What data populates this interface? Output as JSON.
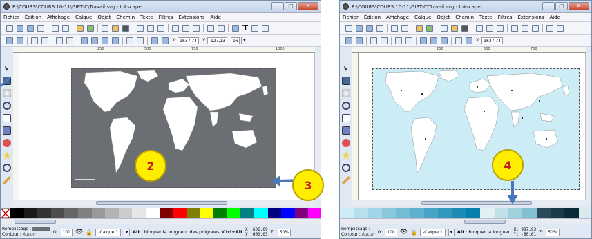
{
  "left_window": {
    "title": "E:\\COURS\\COURS 10-11\\GIPTIC\\Travail.svg - Inkscape",
    "menu": [
      "Fichier",
      "Édition",
      "Affichage",
      "Calque",
      "Objet",
      "Chemin",
      "Texte",
      "Filtres",
      "Extensions",
      "Aide"
    ],
    "x_value": "1637,74",
    "y_value": "-127,13",
    "unit": "px",
    "ruler_marks": [
      "250",
      "500",
      "750",
      "1000"
    ],
    "status": {
      "fill_label": "Remplissage :",
      "stroke_label": "Contour :",
      "stroke_value": "Aucun",
      "opacity_label": "O:",
      "opacity_value": "100",
      "layer": "-Calque 1",
      "message_bold": "Alt",
      "message": " : bloquer la longueur des poignées; ",
      "message_bold2": "Ctrl+Alt",
      "x_coord": "X:  606.09",
      "y_coord": "Y:  600.03",
      "zoom_label": "Z:",
      "zoom": "50%"
    },
    "map_color": "#6b6e72"
  },
  "right_window": {
    "title": "E:\\COURS\\COURS 10-11\\GIPTIC\\Travail.svg - Inkscape",
    "menu": [
      "Fichier",
      "Édition",
      "Affichage",
      "Calque",
      "Objet",
      "Chemin",
      "Texte",
      "Filtres",
      "Extensions",
      "Aide"
    ],
    "x_value": "1637,74",
    "ruler_marks": [
      "250",
      "500",
      "750"
    ],
    "status": {
      "fill_label": "Remplissage :",
      "stroke_label": "Contour :",
      "stroke_value": "Aucun",
      "opacity_label": "O:",
      "opacity_value": "100",
      "layer": "-Calque 1",
      "message_bold": "Alt",
      "message": " : bloquer la longueu",
      "x_coord": "X:  987.93",
      "y_coord": "Y:  -60.61",
      "zoom_label": "Z:",
      "zoom": "50%"
    },
    "map_color": "#ccecf6"
  },
  "badges": [
    "2",
    "3",
    "4"
  ],
  "colors": {
    "arrow": "#4a78b8",
    "badge": "#ffee00",
    "badge_text": "#c81818"
  }
}
